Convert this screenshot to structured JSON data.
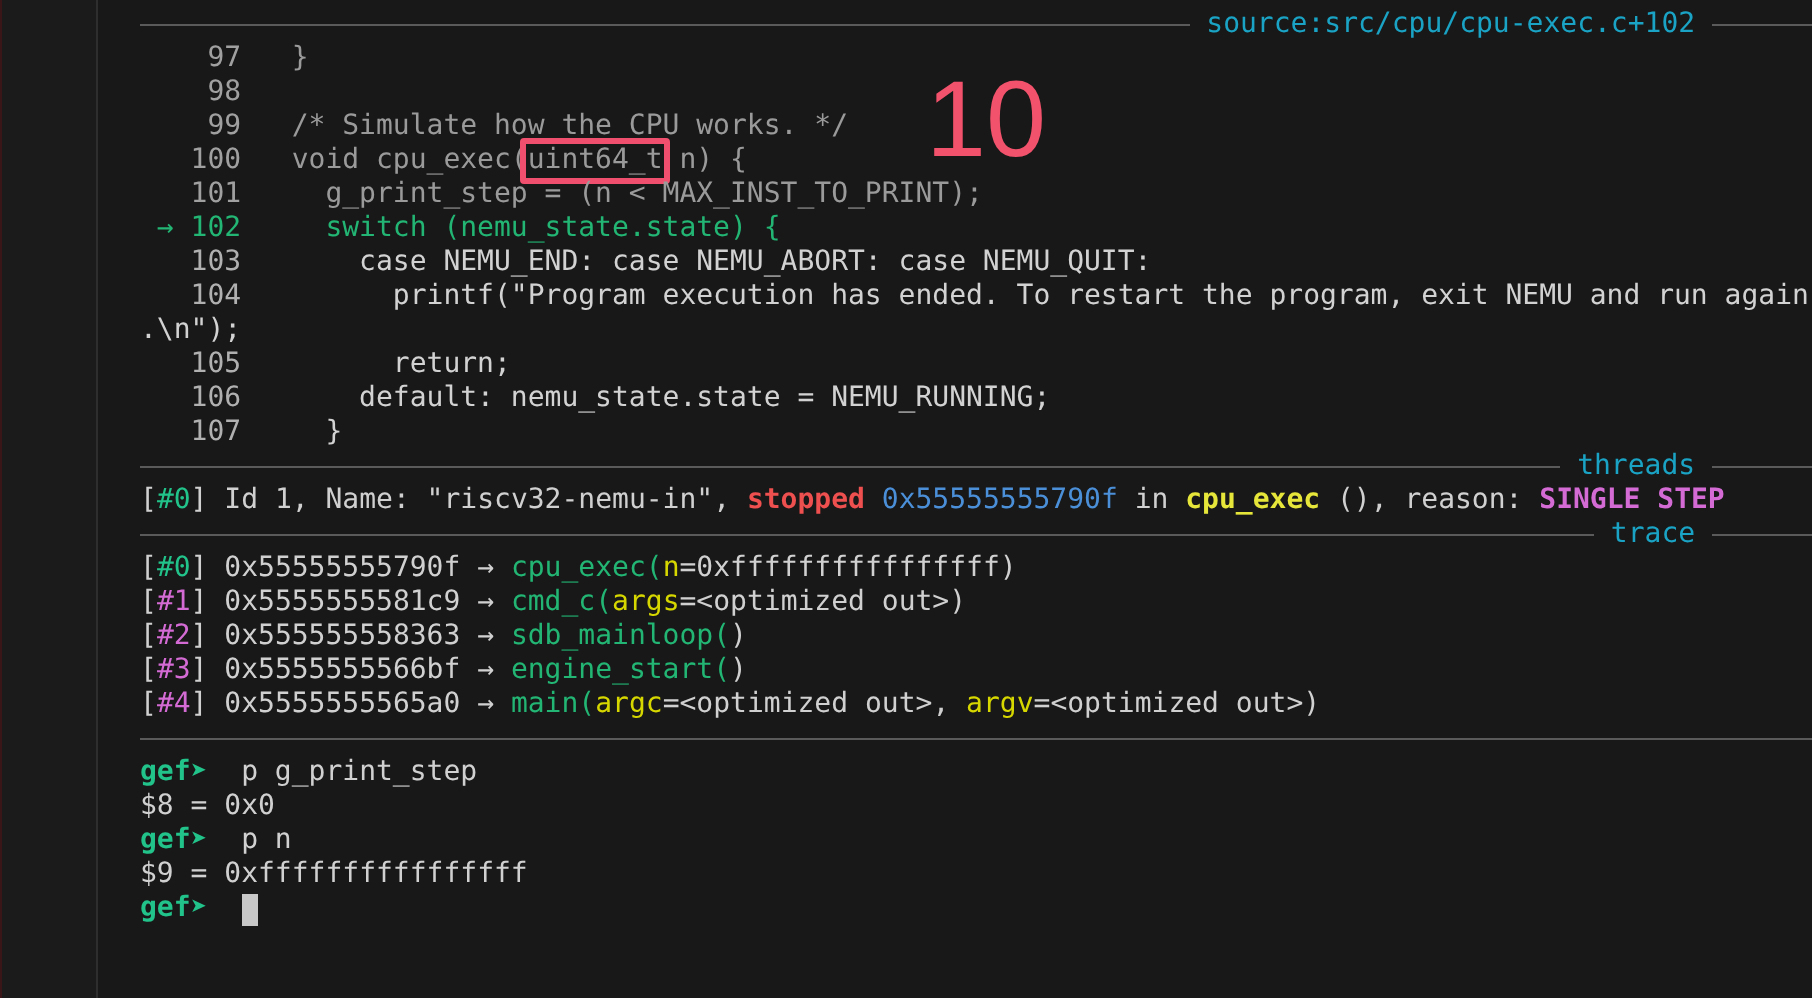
{
  "source_rule": {
    "label": "source:src/cpu/cpu-exec.c+102"
  },
  "annotation": {
    "label": "10"
  },
  "source_lines": [
    {
      "kind": "code",
      "number": "97",
      "current": false,
      "dimmed": true,
      "segments": [
        {
          "text": "}",
          "boxed": false
        }
      ]
    },
    {
      "kind": "code",
      "number": "98",
      "current": false,
      "dimmed": true
    },
    {
      "kind": "code",
      "number": "99",
      "current": false,
      "dimmed": true,
      "segments": [
        {
          "text": "/* Simulate how the CPU works. */",
          "boxed": false
        }
      ]
    },
    {
      "kind": "code",
      "number": "100",
      "current": false,
      "dimmed": true,
      "segments": [
        {
          "text": "void cpu_exec(",
          "boxed": false
        },
        {
          "text": "uint64_t",
          "boxed": true
        },
        {
          "text": " n) {",
          "boxed": false
        }
      ]
    },
    {
      "kind": "code",
      "number": "101",
      "current": false,
      "dimmed": true,
      "segments": [
        {
          "text": "  g_print_step = (n < MAX_INST_TO_PRINT);",
          "boxed": false
        }
      ]
    },
    {
      "kind": "code",
      "number": "102",
      "marker": "→",
      "current": true,
      "dimmed": false,
      "segments": [
        {
          "text": "  switch (nemu_state.state) {",
          "boxed": false
        }
      ]
    },
    {
      "kind": "code",
      "number": "103",
      "current": false,
      "dimmed": false,
      "segments": [
        {
          "text": "    case NEMU_END: case NEMU_ABORT: case NEMU_QUIT:",
          "boxed": false
        }
      ]
    },
    {
      "kind": "code",
      "number": "104",
      "current": false,
      "dimmed": false,
      "segments": [
        {
          "text": "      printf(\"Program execution has ended. To restart the program, exit NEMU and run again",
          "boxed": false
        }
      ]
    },
    {
      "kind": "wrap",
      "current": false,
      "dimmed": false,
      "segments": [
        {
          "text": ".\\n\");",
          "boxed": false
        }
      ]
    },
    {
      "kind": "code",
      "number": "105",
      "current": false,
      "dimmed": false,
      "segments": [
        {
          "text": "      return;",
          "boxed": false
        }
      ]
    },
    {
      "kind": "code",
      "number": "106",
      "current": false,
      "dimmed": false,
      "segments": [
        {
          "text": "    default: nemu_state.state = NEMU_RUNNING;",
          "boxed": false
        }
      ]
    },
    {
      "kind": "code",
      "number": "107",
      "current": false,
      "dimmed": false,
      "segments": [
        {
          "text": "  }",
          "boxed": false
        }
      ]
    }
  ],
  "threads_rule": {
    "label": "threads"
  },
  "threads": [
    {
      "segments": [
        {
          "text": "[",
          "kind": "plain"
        },
        {
          "text": "#0",
          "kind": "index-current"
        },
        {
          "text": "] Id 1, Name: \"riscv32-nemu-in\", ",
          "kind": "plain"
        },
        {
          "text": "stopped ",
          "kind": "status"
        },
        {
          "text": "0x55555555790f",
          "kind": "address"
        },
        {
          "text": " in ",
          "kind": "plain"
        },
        {
          "text": "cpu_exec",
          "kind": "frame"
        },
        {
          "text": " (), reason: ",
          "kind": "plain"
        },
        {
          "text": "SINGLE STEP",
          "kind": "reason"
        }
      ]
    }
  ],
  "trace_rule": {
    "label": "trace"
  },
  "trace": [
    {
      "segments": [
        {
          "text": "[",
          "kind": "plain"
        },
        {
          "text": "#0",
          "kind": "index-current"
        },
        {
          "text": "] 0x55555555790f → ",
          "kind": "plain"
        },
        {
          "text": "cpu_exec(",
          "kind": "function"
        },
        {
          "text": "n",
          "kind": "param"
        },
        {
          "text": "=0xffffffffffffffff)",
          "kind": "plain"
        }
      ]
    },
    {
      "segments": [
        {
          "text": "[",
          "kind": "plain"
        },
        {
          "text": "#1",
          "kind": "index"
        },
        {
          "text": "] 0x5555555581c9 → ",
          "kind": "plain"
        },
        {
          "text": "cmd_c(",
          "kind": "function"
        },
        {
          "text": "args",
          "kind": "param"
        },
        {
          "text": "=<optimized out>)",
          "kind": "plain"
        }
      ]
    },
    {
      "segments": [
        {
          "text": "[",
          "kind": "plain"
        },
        {
          "text": "#2",
          "kind": "index"
        },
        {
          "text": "] 0x555555558363 → ",
          "kind": "plain"
        },
        {
          "text": "sdb_mainloop(",
          "kind": "function"
        },
        {
          "text": ")",
          "kind": "plain"
        }
      ]
    },
    {
      "segments": [
        {
          "text": "[",
          "kind": "plain"
        },
        {
          "text": "#3",
          "kind": "index"
        },
        {
          "text": "] 0x5555555566bf → ",
          "kind": "plain"
        },
        {
          "text": "engine_start(",
          "kind": "function"
        },
        {
          "text": ")",
          "kind": "plain"
        }
      ]
    },
    {
      "segments": [
        {
          "text": "[",
          "kind": "plain"
        },
        {
          "text": "#4",
          "kind": "index"
        },
        {
          "text": "] 0x5555555565a0 → ",
          "kind": "plain"
        },
        {
          "text": "main(",
          "kind": "function"
        },
        {
          "text": "argc",
          "kind": "param"
        },
        {
          "text": "=<optimized out>, ",
          "kind": "plain"
        },
        {
          "text": "argv",
          "kind": "param"
        },
        {
          "text": "=<optimized out>)",
          "kind": "plain"
        }
      ]
    }
  ],
  "console": [
    {
      "kind": "prompt",
      "prompt": "gef➤",
      "command": "p g_print_step",
      "cursor": false
    },
    {
      "kind": "output",
      "text": "$8 = 0x0"
    },
    {
      "kind": "prompt",
      "prompt": "gef➤",
      "command": "p n",
      "cursor": false
    },
    {
      "kind": "output",
      "text": "$9 = 0xffffffffffffffff"
    },
    {
      "kind": "prompt",
      "prompt": "gef➤",
      "cursor": true
    }
  ]
}
